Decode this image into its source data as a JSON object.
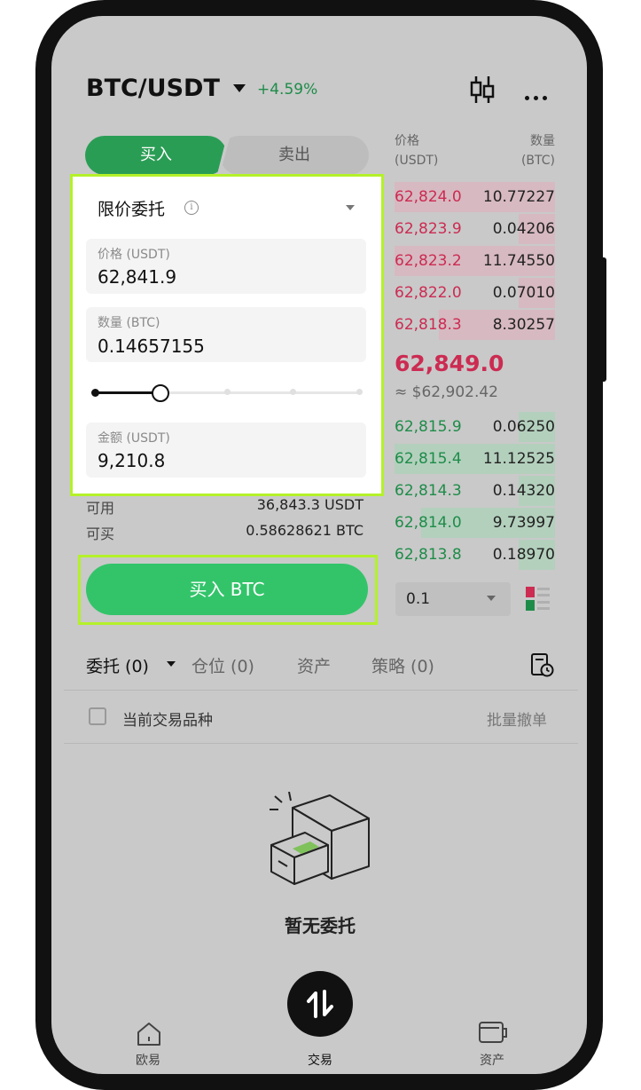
{
  "header": {
    "pair": "BTC/USDT",
    "change": "+4.59%"
  },
  "tabs": {
    "buy": "买入",
    "sell": "卖出"
  },
  "form": {
    "order_type": "限价委托",
    "price_label": "价格 (USDT)",
    "price_value": "62,841.9",
    "amount_label": "数量 (BTC)",
    "amount_value": "0.14657155",
    "slider_percent": 25,
    "total_label": "金额 (USDT)",
    "total_value": "9,210.8"
  },
  "balances": {
    "available_label": "可用",
    "available_value": "36,843.3 USDT",
    "buyable_label": "可买",
    "buyable_value": "0.58628621 BTC"
  },
  "buy_button": "买入 BTC",
  "orderbook": {
    "price_header": [
      "价格",
      "(USDT)"
    ],
    "qty_header": [
      "数量",
      "(BTC)"
    ],
    "asks": [
      {
        "price": "62,824.0",
        "qty": "10.77227"
      },
      {
        "price": "62,823.9",
        "qty": "0.04206"
      },
      {
        "price": "62,823.2",
        "qty": "11.74550"
      },
      {
        "price": "62,822.0",
        "qty": "0.07010"
      },
      {
        "price": "62,818.3",
        "qty": "8.30257"
      }
    ],
    "last_price": "62,849.0",
    "last_price_usd": "≈ $62,902.42",
    "bids": [
      {
        "price": "62,815.9",
        "qty": "0.06250"
      },
      {
        "price": "62,815.4",
        "qty": "11.12525"
      },
      {
        "price": "62,814.3",
        "qty": "0.14320"
      },
      {
        "price": "62,814.0",
        "qty": "9.73997"
      },
      {
        "price": "62,813.8",
        "qty": "0.18970"
      }
    ],
    "depth": "0.1"
  },
  "orders": {
    "tabs": [
      "委托 (0)",
      "仓位 (0)",
      "资产",
      "策略 (0)"
    ],
    "current_pair_label": "当前交易品种",
    "cancel_all": "批量撤单",
    "empty": "暂无委托"
  },
  "nav": {
    "items": [
      "欧易",
      "交易",
      "资产"
    ]
  },
  "colors": {
    "buy": "#33c46a",
    "sell": "#cc2b52",
    "highlight": "#b4f12a"
  },
  "icons": [
    "chevron-down-icon",
    "candlestick-chart-icon",
    "more-icon",
    "info-icon",
    "order-history-icon",
    "empty-drawer-icon",
    "home-icon",
    "swap-icon",
    "wallet-icon",
    "layout-icon"
  ]
}
